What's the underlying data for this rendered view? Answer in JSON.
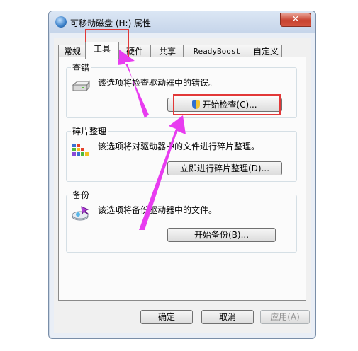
{
  "window": {
    "title": "可移动磁盘 (H:) 属性",
    "close_glyph": "✕"
  },
  "tabs": [
    {
      "label": "常规",
      "active": false
    },
    {
      "label": "工具",
      "active": true
    },
    {
      "label": "硬件",
      "active": false
    },
    {
      "label": "共享",
      "active": false
    },
    {
      "label": "ReadyBoost",
      "active": false
    },
    {
      "label": "自定义",
      "active": false
    }
  ],
  "groups": {
    "error_check": {
      "label": "查错",
      "description": "该选项将检查驱动器中的错误。",
      "button": "开始检查(C)...",
      "icon": "drive-icon"
    },
    "defrag": {
      "label": "碎片整理",
      "description": "该选项将对驱动器中的文件进行碎片整理。",
      "button": "立即进行碎片整理(D)...",
      "icon": "defrag-icon"
    },
    "backup": {
      "label": "备份",
      "description": "该选项将备份驱动器中的文件。",
      "button": "开始备份(B)...",
      "icon": "backup-icon"
    }
  },
  "footer": {
    "ok": "确定",
    "cancel": "取消",
    "apply": "应用(A)",
    "apply_enabled": false
  },
  "annotation_colors": {
    "highlight_box": "#e23838",
    "arrow": "#e83cf0"
  }
}
